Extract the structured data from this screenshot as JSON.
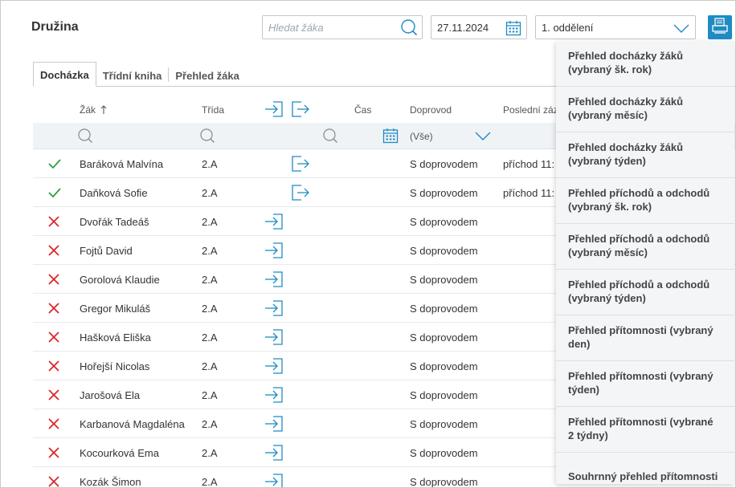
{
  "header": {
    "title": "Družina",
    "search_placeholder": "Hledat žáka",
    "date": "27.11.2024",
    "department": "1. oddělení"
  },
  "tabs": [
    {
      "label": "Docházka",
      "active": true
    },
    {
      "label": "Třídní kniha",
      "active": false
    },
    {
      "label": "Přehled žáka",
      "active": false
    }
  ],
  "table": {
    "columns": {
      "student": "Žák",
      "class": "Třída",
      "time": "Čas",
      "escort": "Doprovod",
      "last_record": "Poslední zázn"
    },
    "filter_escort": "(Vše)",
    "rows": [
      {
        "present": true,
        "name": "Baráková Malvína",
        "class": "2.A",
        "action": "departure",
        "escort": "S doprovodem",
        "last": "příchod 11:"
      },
      {
        "present": true,
        "name": "Daňková Sofie",
        "class": "2.A",
        "action": "departure",
        "escort": "S doprovodem",
        "last": "příchod 11:"
      },
      {
        "present": false,
        "name": "Dvořák Tadeáš",
        "class": "2.A",
        "action": "arrival",
        "escort": "S doprovodem",
        "last": ""
      },
      {
        "present": false,
        "name": "Fojtů David",
        "class": "2.A",
        "action": "arrival",
        "escort": "S doprovodem",
        "last": ""
      },
      {
        "present": false,
        "name": "Gorolová Klaudie",
        "class": "2.A",
        "action": "arrival",
        "escort": "S doprovodem",
        "last": ""
      },
      {
        "present": false,
        "name": "Gregor Mikuláš",
        "class": "2.A",
        "action": "arrival",
        "escort": "S doprovodem",
        "last": ""
      },
      {
        "present": false,
        "name": "Hašková Eliška",
        "class": "2.A",
        "action": "arrival",
        "escort": "S doprovodem",
        "last": ""
      },
      {
        "present": false,
        "name": "Hořejší Nicolas",
        "class": "2.A",
        "action": "arrival",
        "escort": "S doprovodem",
        "last": ""
      },
      {
        "present": false,
        "name": "Jarošová Ela",
        "class": "2.A",
        "action": "arrival",
        "escort": "S doprovodem",
        "last": ""
      },
      {
        "present": false,
        "name": "Karbanová Magdaléna",
        "class": "2.A",
        "action": "arrival",
        "escort": "S doprovodem",
        "last": ""
      },
      {
        "present": false,
        "name": "Kocourková Ema",
        "class": "2.A",
        "action": "arrival",
        "escort": "S doprovodem",
        "last": ""
      },
      {
        "present": false,
        "name": "Kozák Šimon",
        "class": "2.A",
        "action": "arrival",
        "escort": "S doprovodem",
        "last": ""
      }
    ]
  },
  "print_menu": [
    {
      "line1": "Přehled docházky žáků",
      "line2": "(vybraný šk. rok)"
    },
    {
      "line1": "Přehled docházky žáků",
      "line2": "(vybraný měsíc)"
    },
    {
      "line1": "Přehled docházky žáků",
      "line2": "(vybraný týden)"
    },
    {
      "line1": "Přehled příchodů a odchodů",
      "line2": "(vybraný šk. rok)"
    },
    {
      "line1": "Přehled příchodů a odchodů",
      "line2": "(vybraný měsíc)"
    },
    {
      "line1": "Přehled příchodů a odchodů",
      "line2": "(vybraný týden)"
    },
    {
      "line1": "Přehled přítomnosti (vybraný",
      "line2": "den)"
    },
    {
      "line1": "Přehled přítomnosti (vybraný",
      "line2": "týden)"
    },
    {
      "line1": "Přehled přítomnosti (vybrané",
      "line2": "2 týdny)"
    },
    {
      "line1": "Souhrnný přehled přítomnosti",
      "line2": ""
    }
  ],
  "colors": {
    "accent": "#1e8bc3",
    "present": "#2e9e3e",
    "absent": "#d9262b"
  },
  "icons": {
    "search": "search-icon",
    "calendar": "calendar-icon",
    "dropdown": "chevron-down-icon",
    "print": "printer-icon",
    "arrival": "arrival-icon",
    "departure": "departure-icon",
    "sort": "sort-ascending-icon",
    "present": "check-icon",
    "absent": "cross-icon"
  }
}
